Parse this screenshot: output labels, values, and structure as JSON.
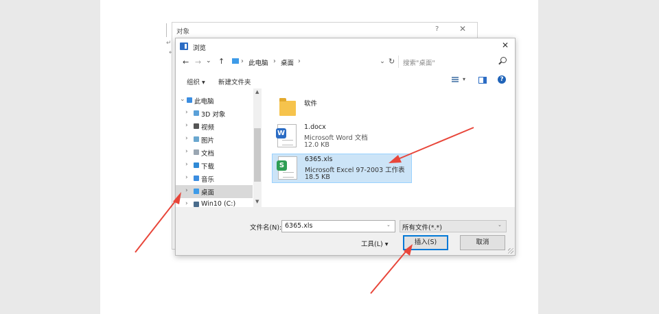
{
  "object_dialog": {
    "title": "对象",
    "help": "?",
    "close": "✕"
  },
  "browse_dialog": {
    "title": "浏览",
    "close": "✕",
    "nav": {
      "back": "←",
      "forward": "→",
      "dropdown": "⌄",
      "up": "↑"
    },
    "breadcrumb": [
      "此电脑",
      "桌面"
    ],
    "breadcrumb_sep": "›",
    "refresh": "↻",
    "address_caret": "⌄",
    "search_placeholder": "搜索\"桌面\"",
    "toolbar": {
      "organize": "组织 ▾",
      "new_folder": "新建文件夹",
      "view_caret": "▾",
      "help": "?"
    },
    "nav_items": [
      {
        "label": "此电脑",
        "chevron": "⌄",
        "icon_color": "#3b8de0"
      },
      {
        "label": "3D 对象",
        "chevron": "›",
        "icon_color": "#5aa0d8"
      },
      {
        "label": "视频",
        "chevron": "›",
        "icon_color": "#555555"
      },
      {
        "label": "图片",
        "chevron": "›",
        "icon_color": "#6aa7cf"
      },
      {
        "label": "文档",
        "chevron": "›",
        "icon_color": "#9aa6b2"
      },
      {
        "label": "下载",
        "chevron": "›",
        "icon_color": "#2f8ad6"
      },
      {
        "label": "音乐",
        "chevron": "›",
        "icon_color": "#3b8de0"
      },
      {
        "label": "桌面",
        "chevron": "›",
        "icon_color": "#3e9be8"
      },
      {
        "label": "Win10 (C:)",
        "chevron": "›",
        "icon_color": "#4a6c8c"
      }
    ],
    "scroll_up": "▲",
    "scroll_down": "▼",
    "files": [
      {
        "name": "软件",
        "type": "",
        "size": "",
        "icon": "folder-icon"
      },
      {
        "name": "1.docx",
        "type": "Microsoft Word 文档",
        "size": "12.0 KB",
        "icon": "word-doc-icon",
        "badge": "W",
        "badge_color": "#2b6cc4"
      },
      {
        "name": "6365.xls",
        "type": "Microsoft Excel 97-2003 工作表",
        "size": "18.5 KB",
        "icon": "excel-sheet-icon",
        "badge": "S",
        "badge_color": "#2e9e54",
        "selected": true
      }
    ],
    "filename_label": "文件名(N):",
    "filename_value": "6365.xls",
    "filetype_value": "所有文件(*.*)",
    "tools_label": "工具(L)  ▾",
    "insert_button": "插入(S)",
    "cancel_button": "取消",
    "select_caret": "⌄"
  },
  "document": {
    "para_mark": "↵"
  },
  "colors": {
    "accent": "#0078d7",
    "selection": "#cce4f7",
    "arrow": "#e8463a"
  }
}
